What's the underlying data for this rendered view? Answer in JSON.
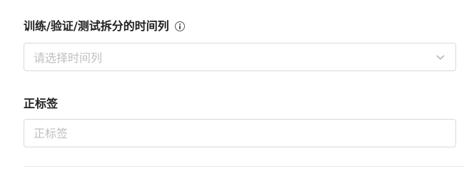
{
  "split_field": {
    "label": "训练/验证/测试拆分的时间列",
    "placeholder": "请选择时间列",
    "info_icon": "info-circle-icon",
    "chevron_icon": "chevron-down-icon"
  },
  "positive_label_field": {
    "label": "正标签",
    "placeholder": "正标签",
    "value": ""
  },
  "colors": {
    "label_text": "#1f1f1f",
    "border": "#d9d9d9",
    "placeholder": "#bfbfbf",
    "divider": "#e8e8e8"
  }
}
